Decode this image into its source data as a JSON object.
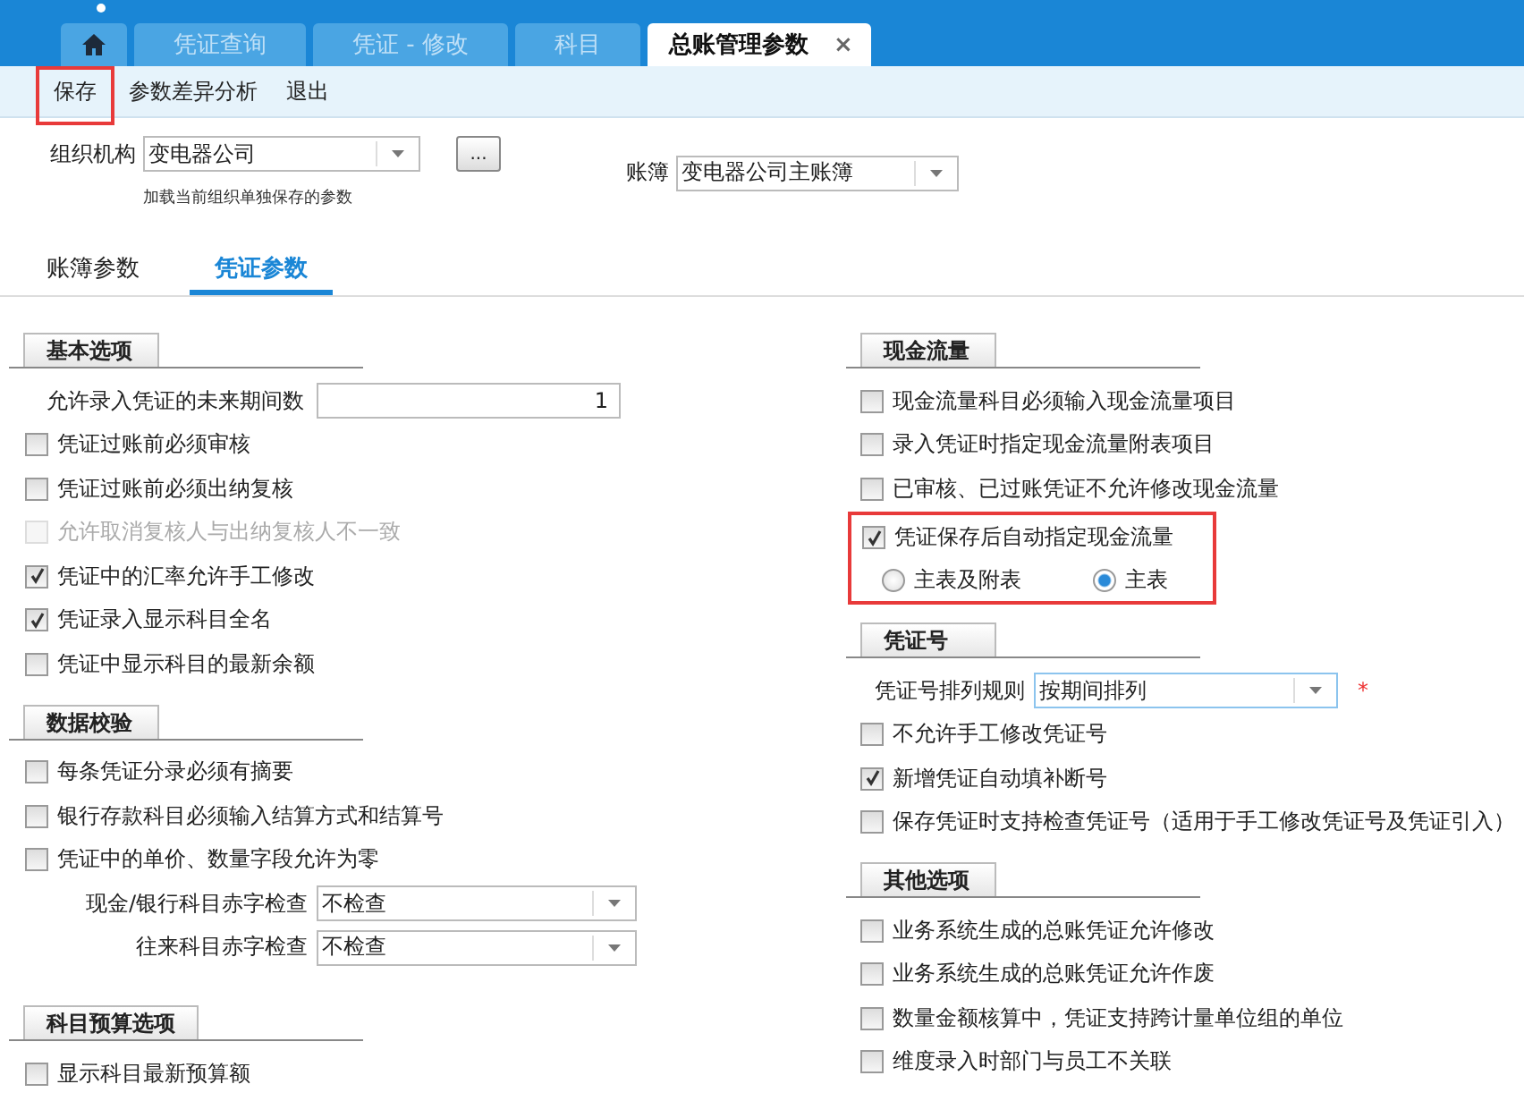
{
  "tabs": [
    {
      "kind": "home",
      "selected": false
    },
    {
      "kind": "text",
      "label": "凭证查询",
      "selected": false
    },
    {
      "kind": "text",
      "label": "凭证 - 修改",
      "selected": false
    },
    {
      "kind": "text",
      "label": "科目",
      "selected": false
    },
    {
      "kind": "text",
      "label": "总账管理参数",
      "selected": true,
      "close": "×"
    }
  ],
  "toolbar": [
    {
      "label": "保存",
      "highlighted": true
    },
    {
      "label": "参数差异分析",
      "highlighted": false
    },
    {
      "label": "退出",
      "highlighted": false
    }
  ],
  "org": {
    "label": "组织机构",
    "value": "变电器公司",
    "browse": "...",
    "hint": "加载当前组织单独保存的参数"
  },
  "ledger": {
    "label": "账簿",
    "value": "变电器公司主账簿"
  },
  "param_tabs": [
    {
      "label": "账簿参数",
      "selected": false
    },
    {
      "label": "凭证参数",
      "selected": true
    }
  ],
  "left_sections": [
    {
      "title": "基本选项",
      "items": [
        {
          "kind": "number",
          "label": "允许录入凭证的未来期间数",
          "value": "1"
        },
        {
          "kind": "checkbox",
          "label": "凭证过账前必须审核",
          "checked": false,
          "disabled": false
        },
        {
          "kind": "checkbox",
          "label": "凭证过账前必须出纳复核",
          "checked": false,
          "disabled": false
        },
        {
          "kind": "checkbox",
          "label": "允许取消复核人与出纳复核人不一致",
          "checked": false,
          "disabled": true
        },
        {
          "kind": "checkbox",
          "label": "凭证中的汇率允许手工修改",
          "checked": true,
          "disabled": false
        },
        {
          "kind": "checkbox",
          "label": "凭证录入显示科目全名",
          "checked": true,
          "disabled": false
        },
        {
          "kind": "checkbox",
          "label": "凭证中显示科目的最新余额",
          "checked": false,
          "disabled": false
        }
      ]
    },
    {
      "title": "数据校验",
      "items": [
        {
          "kind": "checkbox",
          "label": "每条凭证分录必须有摘要",
          "checked": false,
          "disabled": false
        },
        {
          "kind": "checkbox",
          "label": "银行存款科目必须输入结算方式和结算号",
          "checked": false,
          "disabled": false
        },
        {
          "kind": "checkbox",
          "label": "凭证中的单价、数量字段允许为零",
          "checked": false,
          "disabled": false
        },
        {
          "kind": "select",
          "label": "现金/银行科目赤字检查",
          "value": "不检查"
        },
        {
          "kind": "select",
          "label": "往来科目赤字检查",
          "value": "不检查"
        }
      ]
    },
    {
      "title": "科目预算选项",
      "items": [
        {
          "kind": "checkbox",
          "label": "显示科目最新预算额",
          "checked": false,
          "disabled": false
        }
      ]
    }
  ],
  "right_sections": [
    {
      "title": "现金流量",
      "items": [
        {
          "kind": "checkbox",
          "label": "现金流量科目必须输入现金流量项目",
          "checked": false,
          "disabled": false
        },
        {
          "kind": "checkbox",
          "label": "录入凭证时指定现金流量附表项目",
          "checked": false,
          "disabled": false
        },
        {
          "kind": "checkbox",
          "label": "已审核、已过账凭证不允许修改现金流量",
          "checked": false,
          "disabled": false
        },
        {
          "kind": "checkbox_radios",
          "label": "凭证保存后自动指定现金流量",
          "checked": true,
          "highlighted": true,
          "options": [
            {
              "label": "主表及附表",
              "selected": false
            },
            {
              "label": "主表",
              "selected": true
            }
          ]
        }
      ]
    },
    {
      "title": "凭证号",
      "items": [
        {
          "kind": "select",
          "label": "凭证号排列规则",
          "value": "按期间排列",
          "required_mark": "*"
        },
        {
          "kind": "checkbox",
          "label": "不允许手工修改凭证号",
          "checked": false,
          "disabled": false
        },
        {
          "kind": "checkbox",
          "label": "新增凭证自动填补断号",
          "checked": true,
          "disabled": false
        },
        {
          "kind": "checkbox",
          "label": "保存凭证时支持检查凭证号（适用于手工修改凭证号及凭证引入）",
          "checked": false,
          "disabled": false
        }
      ]
    },
    {
      "title": "其他选项",
      "items": [
        {
          "kind": "checkbox",
          "label": "业务系统生成的总账凭证允许修改",
          "checked": false,
          "disabled": false
        },
        {
          "kind": "checkbox",
          "label": "业务系统生成的总账凭证允许作废",
          "checked": false,
          "disabled": false
        },
        {
          "kind": "checkbox",
          "label": "数量金额核算中，凭证支持跨计量单位组的单位",
          "checked": false,
          "disabled": false
        },
        {
          "kind": "checkbox",
          "label": "维度录入时部门与员工不关联",
          "checked": false,
          "disabled": false
        }
      ]
    }
  ]
}
